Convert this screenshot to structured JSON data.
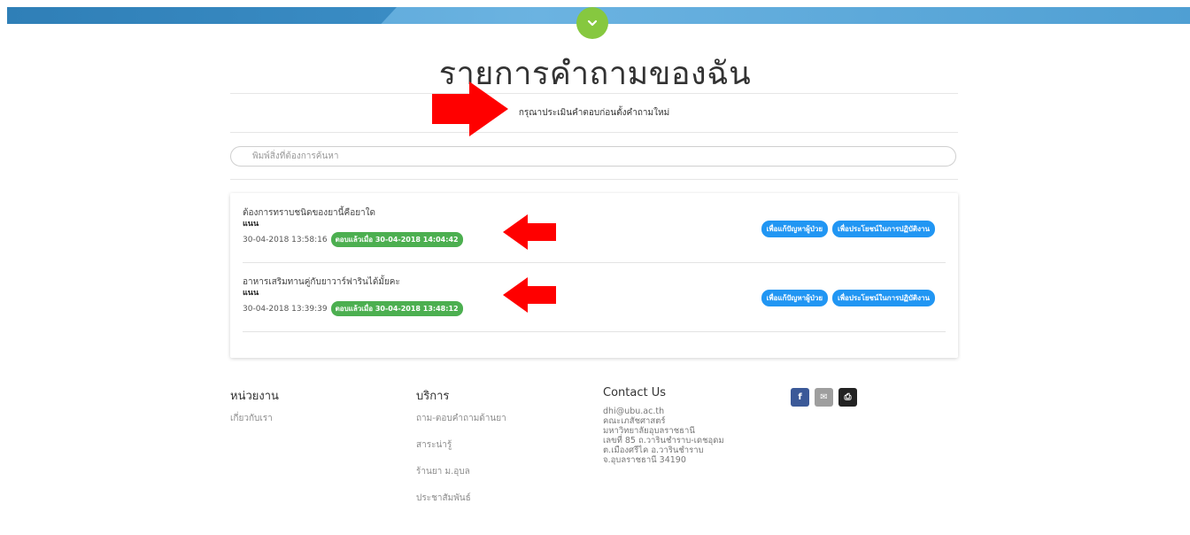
{
  "page": {
    "title": "รายการคำถามของฉัน",
    "notice": "กรุณาประเมินคำตอบก่อนตั้งคำถามใหม่"
  },
  "search": {
    "placeholder": "พิมพ์สิ่งที่ต้องการค้นหา"
  },
  "questions": [
    {
      "title": "ต้องการทราบชนิดของยานี้คือยาใด",
      "user": "แนน",
      "asked_at": "30-04-2018 13:58:16",
      "answered": "ตอบแล้วเมื่อ 30-04-2018 14:04:42",
      "tags": [
        "เพื่อแก้ปัญหาผู้ป่วย",
        "เพื่อประโยชน์ในการปฏิบัติงาน"
      ]
    },
    {
      "title": "อาหารเสริมทานคู่กับยาวาร์ฟารินได้มั้ยคะ",
      "user": "แนน",
      "asked_at": "30-04-2018 13:39:39",
      "answered": "ตอบแล้วเมื่อ 30-04-2018 13:48:12",
      "tags": [
        "เพื่อแก้ปัญหาผู้ป่วย",
        "เพื่อประโยชน์ในการปฏิบัติงาน"
      ]
    }
  ],
  "footer": {
    "unit": {
      "heading": "หน่วยงาน",
      "links": [
        "เกี่ยวกับเรา"
      ]
    },
    "services": {
      "heading": "บริการ",
      "links": [
        "ถาม-ตอบคำถามด้านยา",
        "สาระน่ารู้",
        "ร้านยา ม.อุบล",
        "ประชาสัมพันธ์"
      ]
    },
    "contact": {
      "heading": "Contact Us",
      "lines": [
        "dhi@ubu.ac.th",
        "คณะเภสัชศาสตร์",
        "มหาวิทยาลัยอุบลราชธานี",
        "เลขที่ 85 ถ.วารินชำราบ-เดชอุดม",
        "ต.เมืองศรีไค อ.วารินชำราบ",
        "จ.อุบลราชธานี 34190"
      ]
    },
    "social": [
      {
        "icon": "facebook-icon",
        "glyph": "f",
        "color": "#3b5998"
      },
      {
        "icon": "mail-icon",
        "glyph": "✉",
        "color": "#9e9e9e"
      },
      {
        "icon": "print-icon",
        "glyph": "⎙",
        "color": "#222222"
      }
    ]
  },
  "colors": {
    "accent_green": "#86c83f",
    "tag_blue": "#2196f3",
    "answered_green": "#4caf50",
    "annotation_arrow": "#ff0000"
  }
}
